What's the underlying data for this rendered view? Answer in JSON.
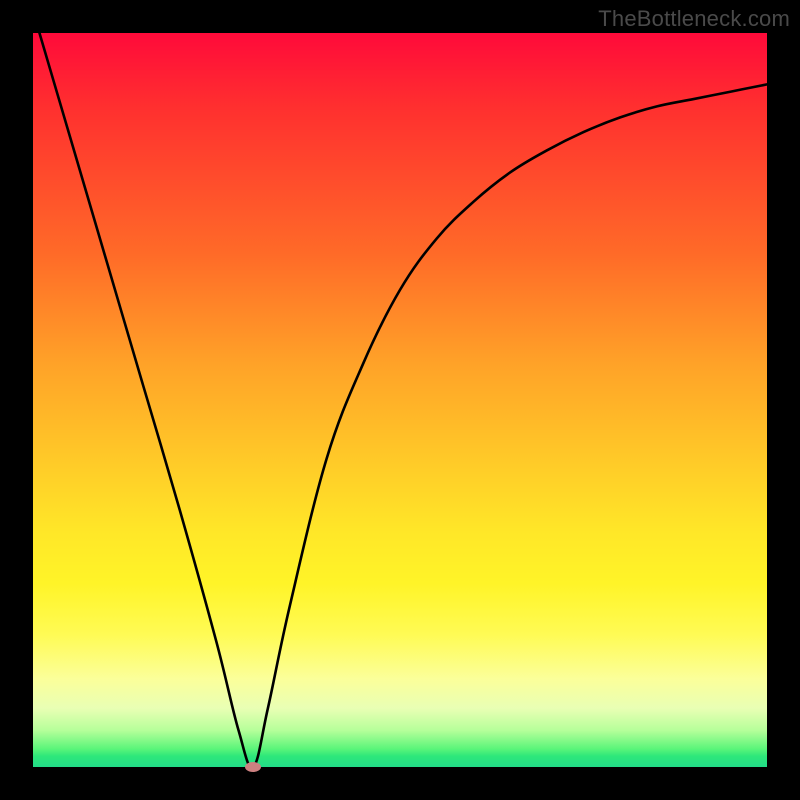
{
  "watermark": "TheBottleneck.com",
  "colors": {
    "frame": "#000000",
    "curve": "#000000",
    "marker": "#cd8181",
    "gradient_top": "#ff0a3a",
    "gradient_bottom": "#22dd88"
  },
  "chart_data": {
    "type": "line",
    "title": "",
    "xlabel": "",
    "ylabel": "",
    "xlim": [
      0,
      100
    ],
    "ylim": [
      0,
      100
    ],
    "grid": false,
    "series": [
      {
        "name": "bottleneck-curve",
        "x": [
          0,
          5,
          10,
          15,
          20,
          25,
          28,
          30,
          32,
          35,
          40,
          45,
          50,
          55,
          60,
          65,
          70,
          75,
          80,
          85,
          90,
          95,
          100
        ],
        "y": [
          103,
          86,
          69,
          52,
          35,
          17,
          5,
          0,
          8,
          22,
          42,
          55,
          65,
          72,
          77,
          81,
          84,
          86.5,
          88.5,
          90,
          91,
          92,
          93
        ]
      }
    ],
    "annotations": [
      {
        "name": "minimum-marker",
        "x": 30,
        "y": 0
      }
    ]
  }
}
